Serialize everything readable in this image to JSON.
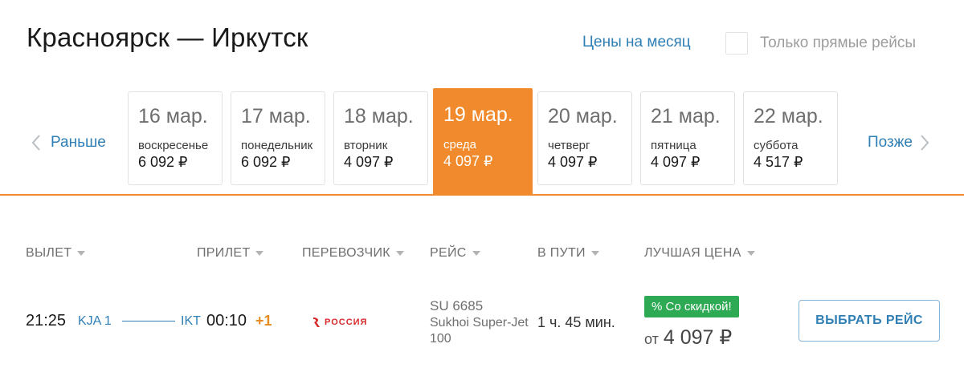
{
  "header": {
    "title": "Красноярск — Иркутск",
    "month_link": "Цены на месяц",
    "direct_only_label": "Только прямые рейсы",
    "direct_only_checked": false
  },
  "date_nav": {
    "prev_label": "Раньше",
    "next_label": "Позже",
    "accent_color": "#f08a2c",
    "days": [
      {
        "date": "16 мар.",
        "weekday": "воскресенье",
        "price": "6 092 ₽",
        "active": false
      },
      {
        "date": "17 мар.",
        "weekday": "понедельник",
        "price": "6 092 ₽",
        "active": false
      },
      {
        "date": "18 мар.",
        "weekday": "вторник",
        "price": "4 097 ₽",
        "active": false
      },
      {
        "date": "19 мар.",
        "weekday": "среда",
        "price": "4 097 ₽",
        "active": true
      },
      {
        "date": "20 мар.",
        "weekday": "четверг",
        "price": "4 097 ₽",
        "active": false
      },
      {
        "date": "21 мар.",
        "weekday": "пятница",
        "price": "4 097 ₽",
        "active": false
      },
      {
        "date": "22 мар.",
        "weekday": "суббота",
        "price": "4 517 ₽",
        "active": false
      }
    ]
  },
  "table": {
    "columns": [
      "ВЫЛЕТ",
      "ПРИЛЕТ",
      "ПЕРЕВОЗЧИК",
      "РЕЙС",
      "В ПУТИ",
      "ЛУЧШАЯ ЦЕНА"
    ],
    "row": {
      "dep_time": "21:25",
      "dep_airport": "KJA 1",
      "arr_airport": "IKT",
      "arr_time": "00:10",
      "day_offset": "+1",
      "carrier_logo_text": "РОССИЯ",
      "carrier_logo_icon": "rossiya-airline-logo",
      "flight_number": "SU 6685",
      "aircraft": "Sukhoi Super-Jet 100",
      "duration": "1 ч. 45 мин.",
      "promo": "% Со скидкой!",
      "promo_color": "#2eaa55",
      "price_prefix": "от",
      "price": "4 097 ₽",
      "select_label": "ВЫБРАТЬ РЕЙС"
    }
  }
}
